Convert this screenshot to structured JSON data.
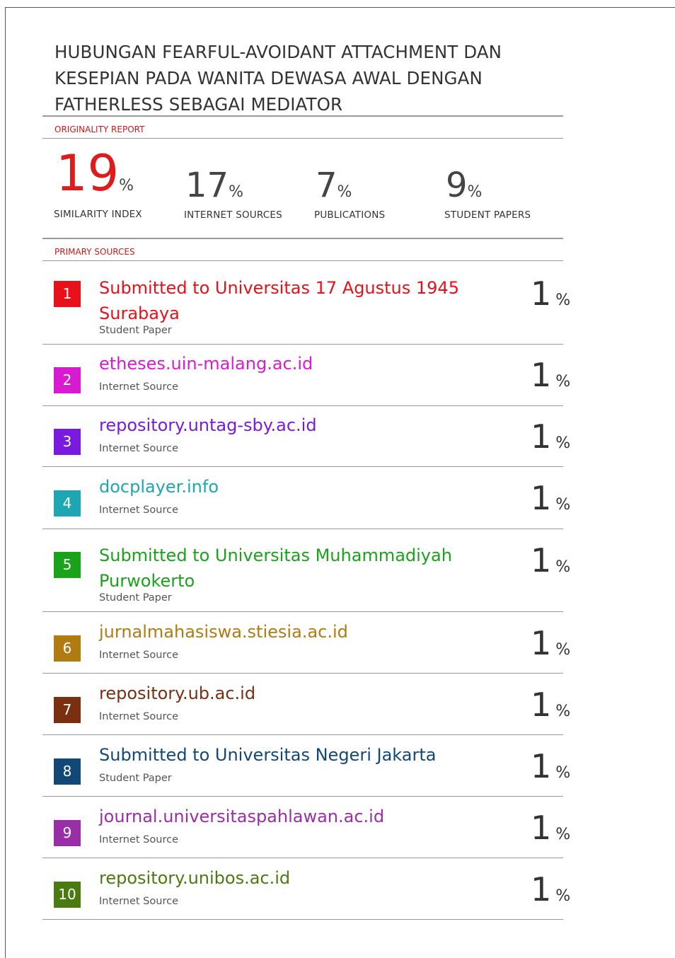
{
  "title": "HUBUNGAN FEARFUL-AVOIDANT ATTACHMENT DAN KESEPIAN PADA WANITA DEWASA AWAL DENGAN FATHERLESS SEBAGAI MEDIATOR",
  "originality_label": "ORIGINALITY REPORT",
  "primary_sources_label": "PRIMARY SOURCES",
  "stats": {
    "similarity": {
      "value": "19",
      "unit": "%",
      "label": "SIMILARITY INDEX"
    },
    "internet": {
      "value": "17",
      "unit": "%",
      "label": "INTERNET SOURCES"
    },
    "publications": {
      "value": "7",
      "unit": "%",
      "label": "PUBLICATIONS"
    },
    "student": {
      "value": "9",
      "unit": "%",
      "label": "STUDENT PAPERS"
    }
  },
  "sources": [
    {
      "num": "1",
      "title": "Submitted to Universitas 17 Agustus 1945 Surabaya",
      "type": "Student Paper",
      "pct": "1",
      "unit": "%",
      "color": "#e8111a"
    },
    {
      "num": "2",
      "title": "etheses.uin-malang.ac.id",
      "type": "Internet Source",
      "pct": "1",
      "unit": "%",
      "color": "#d81bd2"
    },
    {
      "num": "3",
      "title": "repository.untag-sby.ac.id",
      "type": "Internet Source",
      "pct": "1",
      "unit": "%",
      "color": "#7a1ae0"
    },
    {
      "num": "4",
      "title": "docplayer.info",
      "type": "Internet Source",
      "pct": "1",
      "unit": "%",
      "color": "#1fa6b5"
    },
    {
      "num": "5",
      "title": "Submitted to Universitas Muhammadiyah Purwokerto",
      "type": "Student Paper",
      "pct": "1",
      "unit": "%",
      "color": "#1aa31a"
    },
    {
      "num": "6",
      "title": "jurnalmahasiswa.stiesia.ac.id",
      "type": "Internet Source",
      "pct": "1",
      "unit": "%",
      "color": "#b07b10"
    },
    {
      "num": "7",
      "title": "repository.ub.ac.id",
      "type": "Internet Source",
      "pct": "1",
      "unit": "%",
      "color": "#7a3010"
    },
    {
      "num": "8",
      "title": "Submitted to Universitas Negeri Jakarta",
      "type": "Student Paper",
      "pct": "1",
      "unit": "%",
      "color": "#124878"
    },
    {
      "num": "9",
      "title": "journal.universitaspahlawan.ac.id",
      "type": "Internet Source",
      "pct": "1",
      "unit": "%",
      "color": "#9a2ea6"
    },
    {
      "num": "10",
      "title": "repository.unibos.ac.id",
      "type": "Internet Source",
      "pct": "1",
      "unit": "%",
      "color": "#4a7a10"
    }
  ]
}
